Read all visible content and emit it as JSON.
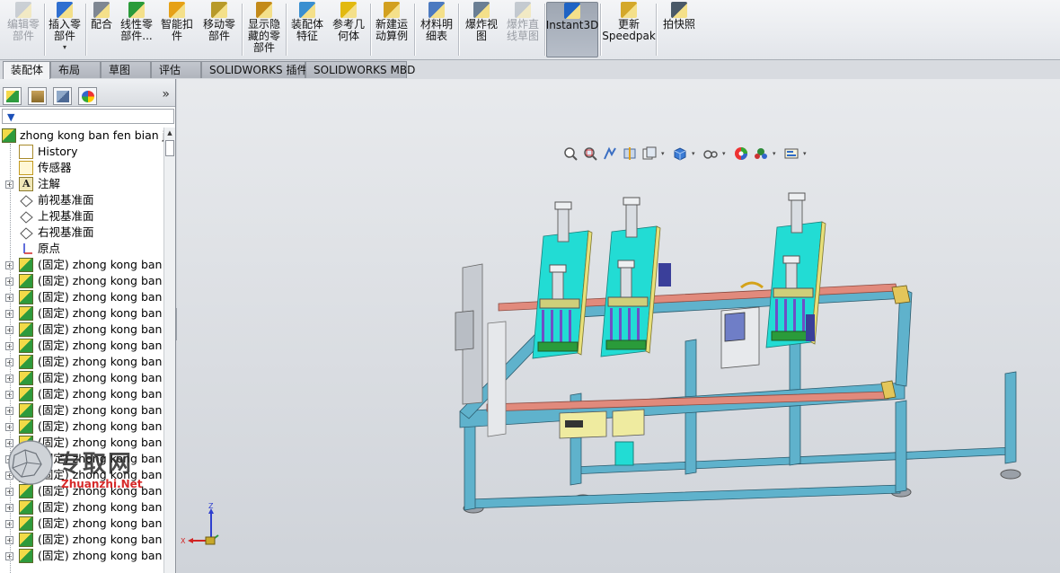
{
  "toolbar": {
    "buttons": [
      {
        "label": "编辑零\n部件",
        "icon": "edit-component-icon",
        "disabled": true
      },
      {
        "label": "插入零\n部件",
        "icon": "insert-component-icon",
        "dropdown": "▾"
      },
      {
        "label": "配合",
        "icon": "mate-icon"
      },
      {
        "label": "线性零\n部件...",
        "icon": "linear-pattern-icon"
      },
      {
        "label": "智能扣\n件",
        "icon": "smart-fasteners-icon"
      },
      {
        "label": "移动零\n部件",
        "icon": "move-component-icon"
      },
      {
        "label": "显示隐\n藏的零\n部件",
        "icon": "show-hidden-icon"
      },
      {
        "label": "装配体\n特征",
        "icon": "assembly-features-icon"
      },
      {
        "label": "参考几\n何体",
        "icon": "reference-geometry-icon"
      },
      {
        "label": "新建运\n动算例",
        "icon": "motion-study-icon"
      },
      {
        "label": "材料明\n细表",
        "icon": "bom-icon"
      },
      {
        "label": "爆炸视\n图",
        "icon": "exploded-view-icon"
      },
      {
        "label": "爆炸直\n线草图",
        "icon": "explode-line-sketch-icon",
        "disabled": true
      },
      {
        "label": "Instant3D",
        "icon": "instant3d-icon",
        "active": true
      },
      {
        "label": "更新\nSpeedpak",
        "icon": "speedpak-icon"
      },
      {
        "label": "拍快照",
        "icon": "snapshot-icon"
      }
    ]
  },
  "tabs": [
    "装配体",
    "布局",
    "草图",
    "评估",
    "SOLIDWORKS 插件",
    "SOLIDWORKS MBD"
  ],
  "active_tab": "装配体",
  "panel": {
    "collapse_label": "»",
    "filter_label": "▼",
    "root": "zhong kong ban fen bian ji",
    "nodes": [
      {
        "label": "History",
        "icon": "history-icon"
      },
      {
        "label": "传感器",
        "icon": "sensor-icon"
      },
      {
        "label": "注解",
        "icon": "annotation-icon",
        "expandable": true
      },
      {
        "label": "前视基准面",
        "icon": "plane-icon"
      },
      {
        "label": "上视基准面",
        "icon": "plane-icon"
      },
      {
        "label": "右视基准面",
        "icon": "plane-icon"
      },
      {
        "label": "原点",
        "icon": "origin-icon"
      }
    ],
    "component_label": "(固定) zhong kong ban f",
    "component_count": 19
  },
  "triad": {
    "z": "Z",
    "x": "X"
  },
  "watermark": {
    "cn": "专取网",
    "en": "Zhuanzhi.Net"
  },
  "colors": {
    "frame": "#5fb2cc",
    "plate": "#22dcd4",
    "rail": "#e18a7c",
    "cylinder": "#d9dde2",
    "accent_green": "#2a9b3a",
    "accent_yellow": "#e8e07a"
  }
}
